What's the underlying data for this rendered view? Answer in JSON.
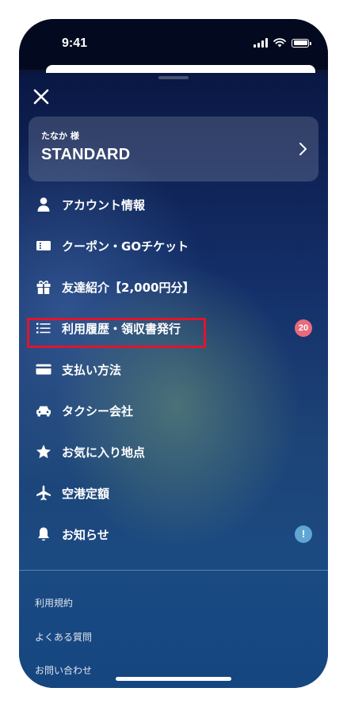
{
  "status_bar": {
    "time": "9:41"
  },
  "profile": {
    "name": "たなか 様",
    "plan": "STANDARD"
  },
  "menu": [
    {
      "label": "アカウント情報",
      "icon": "person-icon"
    },
    {
      "label": "クーポン・GOチケット",
      "icon": "ticket-icon"
    },
    {
      "label": "友達紹介【2,000円分】",
      "icon": "gift-icon"
    },
    {
      "label": "利用履歴・領収書発行",
      "icon": "list-icon",
      "badge": "20",
      "badge_color": "#e96a7c"
    },
    {
      "label": "支払い方法",
      "icon": "credit-card-icon"
    },
    {
      "label": "タクシー会社",
      "icon": "car-icon"
    },
    {
      "label": "お気に入り地点",
      "icon": "star-icon"
    },
    {
      "label": "空港定額",
      "icon": "airplane-icon"
    },
    {
      "label": "お知らせ",
      "icon": "bell-icon",
      "badge": "!",
      "badge_color": "#5fa6d4"
    }
  ],
  "footer_links": [
    "利用規約",
    "よくある質問",
    "お問い合わせ"
  ],
  "colors": {
    "highlight": "#e0152b",
    "sheet_top": "#0a1744",
    "sheet_bottom": "#154680"
  }
}
